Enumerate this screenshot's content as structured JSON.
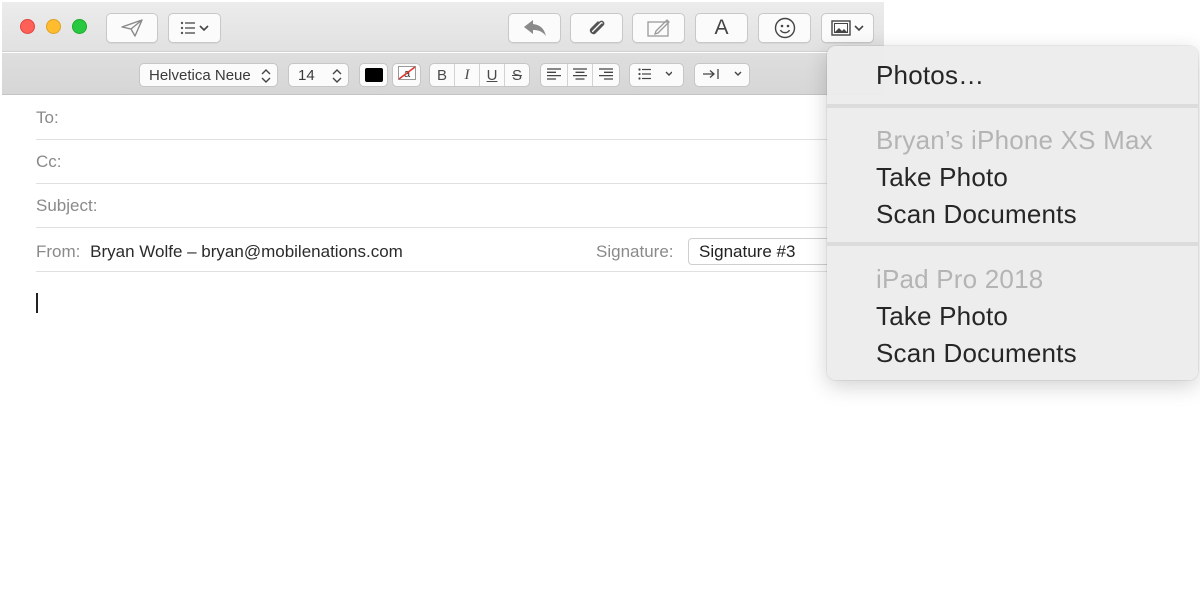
{
  "toolbar": {
    "send_icon": "paper-plane-icon",
    "header_fields_icon": "list-icon",
    "reply_icon": "reply-arrow-icon",
    "attach_icon": "paperclip-icon",
    "markup_icon": "markup-icon",
    "format_label": "A",
    "emoji_icon": "smiley-icon",
    "photo_browser_icon": "photo-icon"
  },
  "format": {
    "font_family": "Helvetica Neue",
    "font_size": "14",
    "bold": "B",
    "italic": "I",
    "underline": "U",
    "strikethrough": "S",
    "indent_icon": "indent-icon"
  },
  "header": {
    "to_label": "To:",
    "cc_label": "Cc:",
    "subject_label": "Subject:",
    "from_label": "From:",
    "from_value": "Bryan Wolfe – bryan@mobilenations.com",
    "signature_label": "Signature:",
    "signature_value": "Signature #3"
  },
  "menu": {
    "photos": "Photos…",
    "device1": {
      "name": "Bryan’s iPhone XS Max",
      "take_photo": "Take Photo",
      "scan_documents": "Scan Documents"
    },
    "device2": {
      "name": "iPad Pro 2018",
      "take_photo": "Take Photo",
      "scan_documents": "Scan Documents"
    }
  },
  "colors": {
    "close": "#fe5f57",
    "minimize": "#febc2e",
    "zoom": "#28c840"
  }
}
